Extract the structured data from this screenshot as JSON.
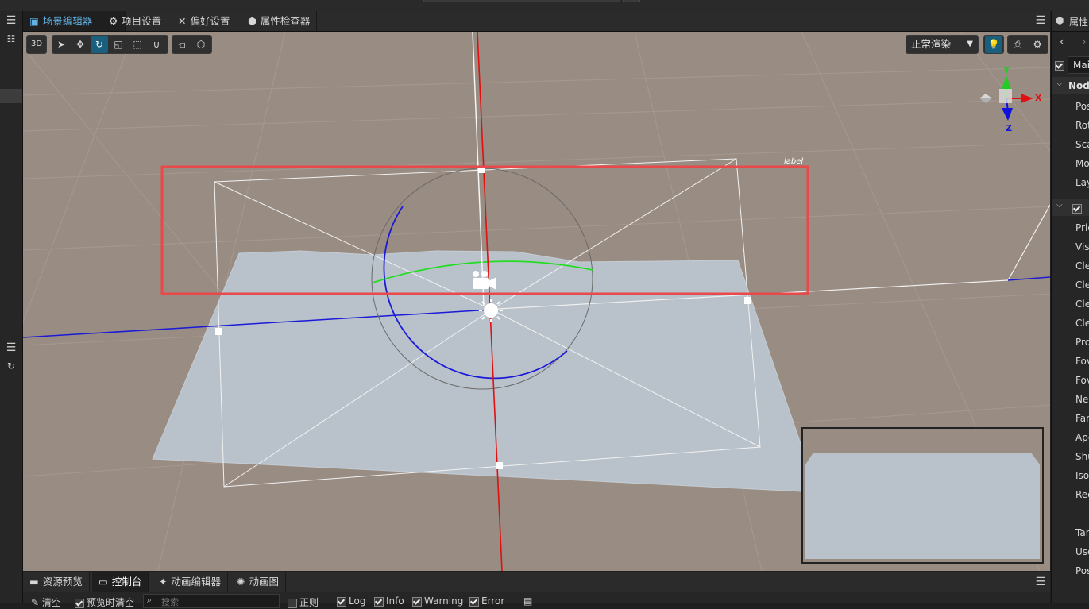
{
  "top_tabs": [
    {
      "label": "场景编辑器",
      "icon": "scene-icon",
      "active": true
    },
    {
      "label": "项目设置",
      "icon": "gear-icon",
      "active": false
    },
    {
      "label": "偏好设置",
      "icon": "tools-icon",
      "active": false
    },
    {
      "label": "属性检查器",
      "icon": "cube-icon",
      "active": false
    }
  ],
  "viewport": {
    "mode_3d": "3D",
    "render_mode": "正常渲染",
    "gizmo_label": "label",
    "axis_labels": {
      "x": "X",
      "y": "Y",
      "z": "Z"
    }
  },
  "right_panel": {
    "title": "属性",
    "node_name": "Mai",
    "section_node": "Node",
    "node_props": [
      "Pos",
      "Rot",
      "Sca",
      "Mol",
      "Lay"
    ],
    "camera_props": [
      "Pric",
      "Visi",
      "Cle",
      "Cle",
      "Cle",
      "Cle",
      "Pro",
      "Fov",
      "Fov",
      "Nea",
      "Far",
      "Ape",
      "Shu",
      "Iso",
      "Rec",
      "Tarc",
      "Use",
      "Pos"
    ]
  },
  "bottom_tabs": [
    {
      "label": "资源预览",
      "icon": "folder-icon",
      "active": false
    },
    {
      "label": "控制台",
      "icon": "terminal-icon",
      "active": true
    },
    {
      "label": "动画编辑器",
      "icon": "run-icon",
      "active": false
    },
    {
      "label": "动画图",
      "icon": "graph-icon",
      "active": false
    }
  ],
  "console": {
    "clear_label": "清空",
    "clear_on_preview_label": "预览时清空",
    "search_placeholder": "搜索",
    "regex_label": "正则",
    "log_label": "Log",
    "info_label": "Info",
    "warning_label": "Warning",
    "error_label": "Error"
  },
  "colors": {
    "viewport_bg": "#998c83",
    "accent": "#5fb3e6",
    "highlight_box": "#e8494a",
    "axis_x": "#e01010",
    "axis_y": "#22cc22",
    "axis_z": "#1010dd"
  }
}
